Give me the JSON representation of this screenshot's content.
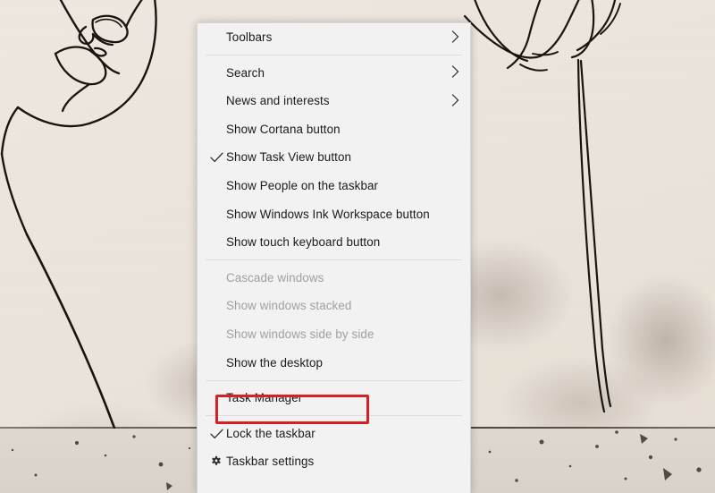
{
  "desktop": {
    "wallpaper_description": "line-art face drawing and single-line flower on cream paper",
    "background_color": "#ece5dc",
    "ink_color": "#1a1410"
  },
  "context_menu": {
    "name": "taskbar-context-menu",
    "accent_highlight_color": "#d81f24",
    "background_color": "#f2f2f2",
    "groups": [
      {
        "items": [
          {
            "label": "Toolbars",
            "glyph": "none",
            "submenu": true,
            "enabled": true,
            "checked": false
          }
        ]
      },
      {
        "items": [
          {
            "label": "Search",
            "glyph": "none",
            "submenu": true,
            "enabled": true,
            "checked": false
          },
          {
            "label": "News and interests",
            "glyph": "none",
            "submenu": true,
            "enabled": true,
            "checked": false
          },
          {
            "label": "Show Cortana button",
            "glyph": "none",
            "submenu": false,
            "enabled": true,
            "checked": false
          },
          {
            "label": "Show Task View button",
            "glyph": "check-icon",
            "submenu": false,
            "enabled": true,
            "checked": true
          },
          {
            "label": "Show People on the taskbar",
            "glyph": "none",
            "submenu": false,
            "enabled": true,
            "checked": false
          },
          {
            "label": "Show Windows Ink Workspace button",
            "glyph": "none",
            "submenu": false,
            "enabled": true,
            "checked": false
          },
          {
            "label": "Show touch keyboard button",
            "glyph": "none",
            "submenu": false,
            "enabled": true,
            "checked": false
          }
        ]
      },
      {
        "items": [
          {
            "label": "Cascade windows",
            "glyph": "none",
            "submenu": false,
            "enabled": false,
            "checked": false
          },
          {
            "label": "Show windows stacked",
            "glyph": "none",
            "submenu": false,
            "enabled": false,
            "checked": false
          },
          {
            "label": "Show windows side by side",
            "glyph": "none",
            "submenu": false,
            "enabled": false,
            "checked": false
          },
          {
            "label": "Show the desktop",
            "glyph": "none",
            "submenu": false,
            "enabled": true,
            "checked": false
          }
        ]
      },
      {
        "items": [
          {
            "label": "Task Manager",
            "glyph": "none",
            "submenu": false,
            "enabled": true,
            "checked": false,
            "highlighted": true
          }
        ]
      },
      {
        "items": [
          {
            "label": "Lock the taskbar",
            "glyph": "check-icon",
            "submenu": false,
            "enabled": true,
            "checked": true
          },
          {
            "label": "Taskbar settings",
            "glyph": "gear-icon",
            "submenu": false,
            "enabled": true,
            "checked": false
          }
        ]
      }
    ]
  }
}
